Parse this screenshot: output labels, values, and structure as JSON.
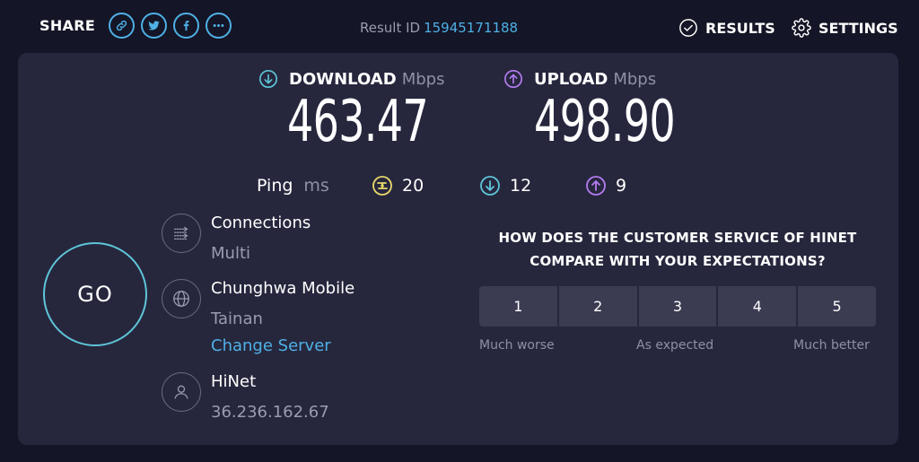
{
  "topbar": {
    "share_label": "SHARE",
    "share_buttons": [
      "link-icon",
      "twitter-icon",
      "facebook-icon",
      "more-icon"
    ],
    "result_label": "Result ID",
    "result_id": "15945171188",
    "results_label": "RESULTS",
    "settings_label": "SETTINGS"
  },
  "download": {
    "label": "DOWNLOAD",
    "unit": "Mbps",
    "value": "463.47"
  },
  "upload": {
    "label": "UPLOAD",
    "unit": "Mbps",
    "value": "498.90"
  },
  "ping": {
    "label": "Ping",
    "unit": "ms",
    "idle": "20",
    "download": "12",
    "upload": "9"
  },
  "go_label": "GO",
  "connections": {
    "title": "Connections",
    "value": "Multi"
  },
  "server": {
    "title": "Chunghwa Mobile",
    "location": "Tainan",
    "change_label": "Change Server"
  },
  "provider": {
    "title": "HiNet",
    "ip": "36.236.162.67"
  },
  "survey": {
    "question_line1": "HOW DOES THE CUSTOMER SERVICE OF HINET",
    "question_line2": "COMPARE WITH YOUR EXPECTATIONS?",
    "options": [
      "1",
      "2",
      "3",
      "4",
      "5"
    ],
    "low_label": "Much worse",
    "mid_label": "As expected",
    "high_label": "Much better"
  },
  "colors": {
    "background": "#141526",
    "panel": "#26273d",
    "accent_blue": "#4fb0e6",
    "download_teal": "#5ec5d8",
    "upload_purple": "#b47cf0",
    "ping_yellow": "#e8d86a"
  }
}
